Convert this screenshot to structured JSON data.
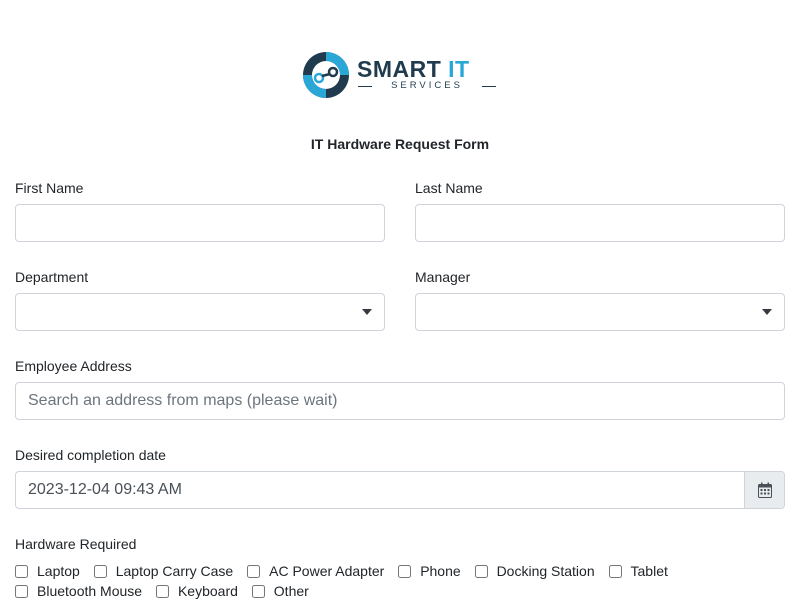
{
  "logo": {
    "brand_main": "SMART",
    "brand_accent": "IT",
    "brand_sub": "SERVICES",
    "colors": {
      "dark": "#1f3b4d",
      "accent": "#29a8d8"
    }
  },
  "form": {
    "title": "IT Hardware Request Form",
    "first_name": {
      "label": "First Name",
      "value": ""
    },
    "last_name": {
      "label": "Last Name",
      "value": ""
    },
    "department": {
      "label": "Department",
      "value": ""
    },
    "manager": {
      "label": "Manager",
      "value": ""
    },
    "address": {
      "label": "Employee Address",
      "placeholder": "Search an address from maps (please wait)",
      "value": ""
    },
    "date": {
      "label": "Desired completion date",
      "value": "2023-12-04 09:43 AM",
      "icon": "calendar-icon"
    },
    "hardware": {
      "label": "Hardware Required",
      "options": [
        {
          "label": "Laptop",
          "checked": false
        },
        {
          "label": "Laptop Carry Case",
          "checked": false
        },
        {
          "label": "AC Power Adapter",
          "checked": false
        },
        {
          "label": "Phone",
          "checked": false
        },
        {
          "label": "Docking Station",
          "checked": false
        },
        {
          "label": "Tablet",
          "checked": false
        },
        {
          "label": "Bluetooth Mouse",
          "checked": false
        },
        {
          "label": "Keyboard",
          "checked": false
        },
        {
          "label": "Other",
          "checked": false
        }
      ]
    }
  }
}
